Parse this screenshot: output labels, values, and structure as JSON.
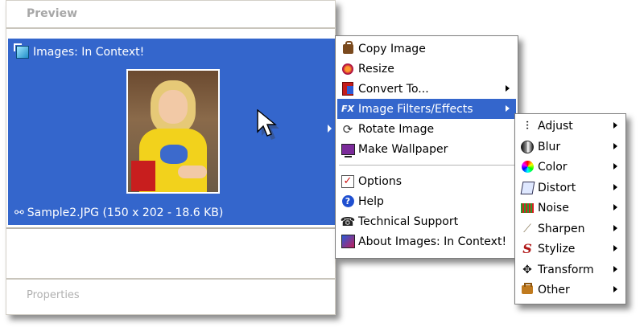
{
  "panel": {
    "header": "Preview",
    "footer": "Properties",
    "selection": {
      "title": "Images: In Context!",
      "file": "Sample2.JPG (150 x 202 - 18.6 KB)"
    }
  },
  "main_menu": {
    "items": [
      {
        "label": "Copy Image",
        "icon": "copy-icon"
      },
      {
        "label": "Resize",
        "icon": "resize-icon"
      },
      {
        "label": "Convert To...",
        "icon": "convert-icon",
        "submenu": true
      },
      {
        "label": "Image Filters/Effects",
        "icon": "fx-icon",
        "submenu": true,
        "highlighted": true
      },
      {
        "label": "Rotate Image",
        "icon": "rotate-icon"
      },
      {
        "label": "Make Wallpaper",
        "icon": "wallpaper-icon"
      },
      {
        "label": "Options",
        "icon": "options-icon"
      },
      {
        "label": "Help",
        "icon": "help-icon"
      },
      {
        "label": "Technical Support",
        "icon": "support-icon"
      },
      {
        "label": "About Images: In Context!",
        "icon": "about-icon"
      }
    ]
  },
  "sub_menu": {
    "items": [
      {
        "label": "Adjust",
        "icon": "adjust-icon"
      },
      {
        "label": "Blur",
        "icon": "blur-icon"
      },
      {
        "label": "Color",
        "icon": "color-icon"
      },
      {
        "label": "Distort",
        "icon": "distort-icon"
      },
      {
        "label": "Noise",
        "icon": "noise-icon"
      },
      {
        "label": "Sharpen",
        "icon": "sharpen-icon"
      },
      {
        "label": "Stylize",
        "icon": "stylize-icon"
      },
      {
        "label": "Transform",
        "icon": "transform-icon"
      },
      {
        "label": "Other",
        "icon": "other-icon"
      }
    ]
  },
  "colors": {
    "selection": "#3466cc",
    "highlight": "#3466cc",
    "menu_border": "#7d7d7d"
  }
}
